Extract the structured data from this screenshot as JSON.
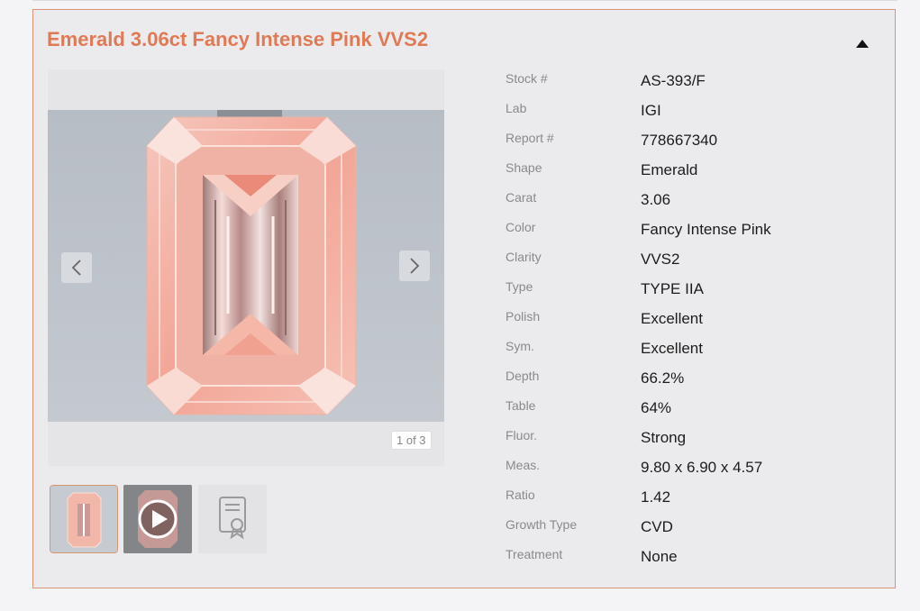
{
  "card": {
    "title": "Emerald 3.06ct Fancy Intense Pink VVS2",
    "title_color": "#e07a55",
    "border_color": "#d99475",
    "collapse_icon": "caret-up-icon"
  },
  "gallery": {
    "counter": "1 of 3",
    "prev_icon": "chevron-left-icon",
    "next_icon": "chevron-right-icon",
    "thumbnails": [
      {
        "name": "diamond-image-thumbnail",
        "selected": true
      },
      {
        "name": "video-thumbnail",
        "icon": "play-icon"
      },
      {
        "name": "certificate-thumbnail",
        "icon": "certificate-icon"
      }
    ]
  },
  "specs": [
    {
      "label": "Stock #",
      "value": "AS-393/F"
    },
    {
      "label": "Lab",
      "value": "IGI"
    },
    {
      "label": "Report #",
      "value": "778667340"
    },
    {
      "label": "Shape",
      "value": "Emerald"
    },
    {
      "label": "Carat",
      "value": "3.06"
    },
    {
      "label": "Color",
      "value": "Fancy Intense Pink"
    },
    {
      "label": "Clarity",
      "value": "VVS2"
    },
    {
      "label": "Type",
      "value": "TYPE IIA"
    },
    {
      "label": "Polish",
      "value": "Excellent"
    },
    {
      "label": "Sym.",
      "value": "Excellent"
    },
    {
      "label": "Depth",
      "value": "66.2%"
    },
    {
      "label": "Table",
      "value": "64%"
    },
    {
      "label": "Fluor.",
      "value": "Strong"
    },
    {
      "label": "Meas.",
      "value": "9.80 x 6.90 x 4.57"
    },
    {
      "label": "Ratio",
      "value": "1.42"
    },
    {
      "label": "Growth Type",
      "value": "CVD"
    },
    {
      "label": "Treatment",
      "value": "None"
    }
  ]
}
